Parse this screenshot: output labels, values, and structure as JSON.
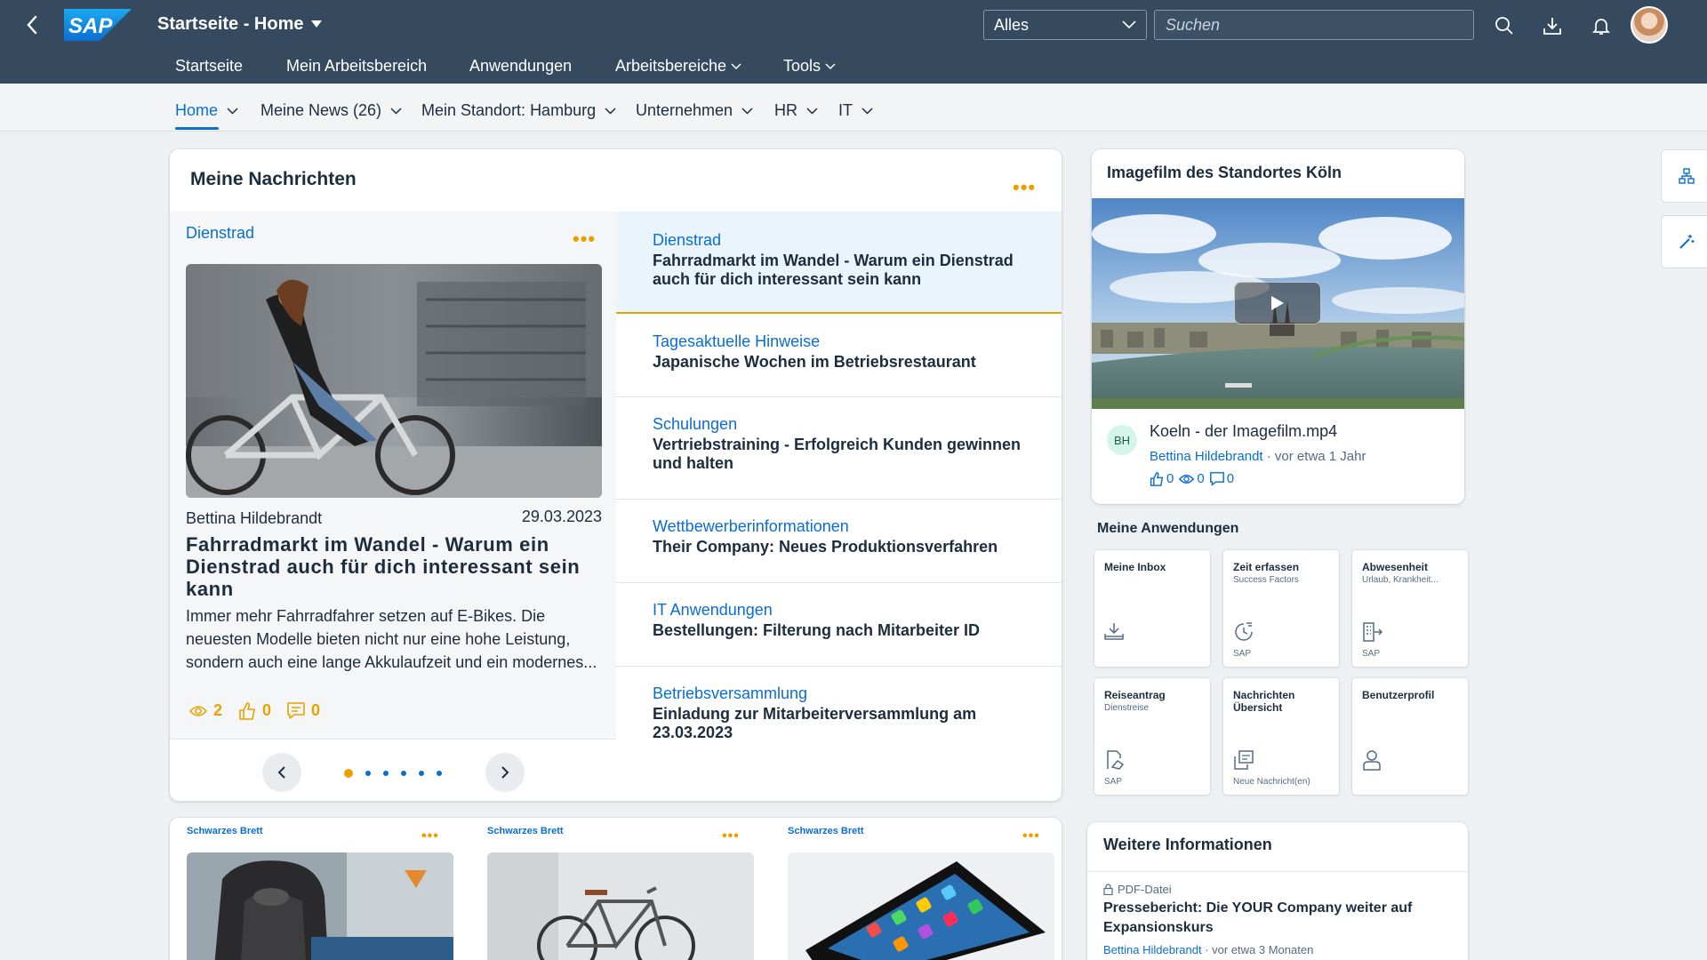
{
  "shell": {
    "title": "Startseite - Home",
    "scope": "Alles",
    "search_placeholder": "Suchen",
    "nav": [
      "Startseite",
      "Mein Arbeitsbereich",
      "Anwendungen",
      "Arbeitsbereiche",
      "Tools"
    ]
  },
  "subnav": [
    "Home",
    "Meine News (26)",
    "Mein Standort: Hamburg",
    "Unternehmen",
    "HR",
    "IT"
  ],
  "news": {
    "title": "Meine Nachrichten",
    "featured": {
      "category": "Dienstrad",
      "author": "Bettina Hildebrandt",
      "date": "29.03.2023",
      "title": "Fahrradmarkt im Wandel - Warum ein Dienstrad auch für dich interessant sein kann",
      "teaser": "Immer mehr Fahrradfahrer setzen auf E-Bikes. Die neuesten Modelle bieten nicht nur eine hohe Leistung, sondern auch eine lange Akkulaufzeit und ein modernes...",
      "views": "2",
      "likes": "0",
      "comments": "0"
    },
    "carousel_total": 6,
    "carousel_active": 1,
    "items": [
      {
        "category": "Dienstrad",
        "title": "Fahrradmarkt im Wandel - Warum ein Dienstrad auch für dich interessant sein kann"
      },
      {
        "category": "Tagesaktuelle Hinweise",
        "title": "Japanische Wochen im Betriebsrestaurant"
      },
      {
        "category": "Schulungen",
        "title": "Vertriebstraining - Erfolgreich Kunden gewinnen und halten"
      },
      {
        "category": "Wettbewerberinformationen",
        "title": "Their Company: Neues Produktionsverfahren"
      },
      {
        "category": "IT Anwendungen",
        "title": "Bestellungen: Filterung nach Mitarbeiter ID"
      },
      {
        "category": "Betriebsversammlung",
        "title": "Einladung zur Mitarbeiterversammlung am 23.03.2023"
      }
    ]
  },
  "video": {
    "title": "Imagefilm des Standortes Köln",
    "badge": "BH",
    "file": "Koeln - der Imagefilm.mp4",
    "author": "Bettina Hildebrandt",
    "age": "· vor etwa 1 Jahr",
    "likes": "0",
    "views": "0",
    "comments": "0"
  },
  "apps": {
    "title": "Meine Anwendungen",
    "tiles": [
      {
        "title": "Meine Inbox",
        "subtitle": "",
        "footer": "",
        "icon": "inbox-icon"
      },
      {
        "title": "Zeit erfassen",
        "subtitle": "Success Factors",
        "footer": "SAP",
        "icon": "time-icon"
      },
      {
        "title": "Abwesenheit",
        "subtitle": "Urlaub, Krankheit...",
        "footer": "SAP",
        "icon": "absence-icon"
      },
      {
        "title": "Reiseantrag",
        "subtitle": "Dienstreise",
        "footer": "SAP",
        "icon": "travel-icon"
      },
      {
        "title": "Nachrichten Übersicht",
        "subtitle": "",
        "footer": "Neue Nachricht(en)",
        "icon": "messages-icon"
      },
      {
        "title": "Benutzerprofil",
        "subtitle": "",
        "footer": "",
        "icon": "user-icon"
      }
    ]
  },
  "board": [
    "Schwarzes Brett",
    "Schwarzes Brett",
    "Schwarzes Brett"
  ],
  "info": {
    "title": "Weitere Informationen",
    "type": "PDF-Datei",
    "doc_title": "Pressebericht: Die YOUR Company weiter auf Expansionskurs",
    "author": "Bettina Hildebrandt",
    "age": "· vor etwa 3 Monaten"
  },
  "colors": {
    "shell": "#354a5f",
    "link": "#0a6ed1",
    "accent": "#e9a100",
    "selected_bg": "#eaf4fc"
  }
}
